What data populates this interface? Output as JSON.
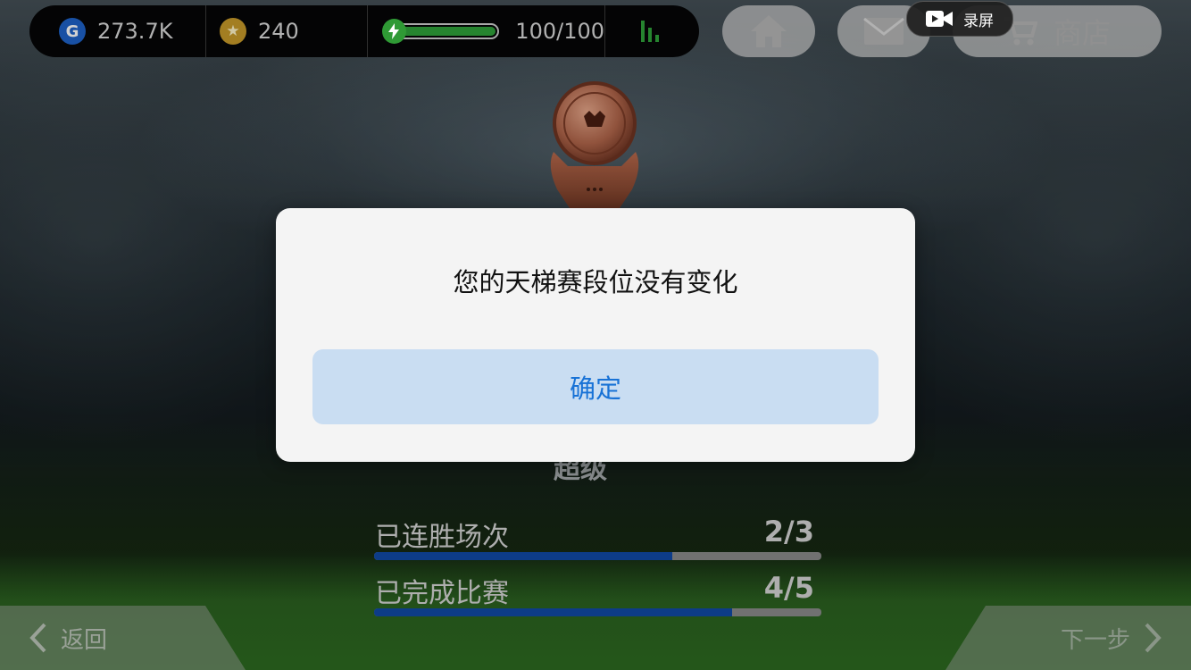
{
  "topbar": {
    "gp_value": "273.7K",
    "gp_icon_letter": "G",
    "coins_value": "240",
    "coin_icon": "★",
    "energy_value": "100/100",
    "energy_fraction": 1.0,
    "energy_icon": "lightning-icon",
    "stats_icon": "signal-bars-icon"
  },
  "nav_buttons": {
    "home_icon": "home-icon",
    "mail_icon": "mail-icon",
    "shop_icon": "cart-icon",
    "shop_label": "商店"
  },
  "recording_badge": {
    "icon": "video-camera-icon",
    "label": "录屏"
  },
  "rank": {
    "label": "超级"
  },
  "progress": [
    {
      "label": "已连胜场次",
      "value": "2/3",
      "fraction": 0.667
    },
    {
      "label": "已完成比赛",
      "value": "4/5",
      "fraction": 0.8
    }
  ],
  "bottom_nav": {
    "back_label": "返回",
    "next_label": "下一步"
  },
  "dialog": {
    "message": "您的天梯赛段位没有变化",
    "confirm_label": "确定"
  },
  "colors": {
    "accent_blue": "#1872d6",
    "confirm_bg": "#c9ddf2",
    "energy_green": "#2fa23a",
    "progress_blue": "#114aa6",
    "trophy_bronze": "#b0654a"
  }
}
